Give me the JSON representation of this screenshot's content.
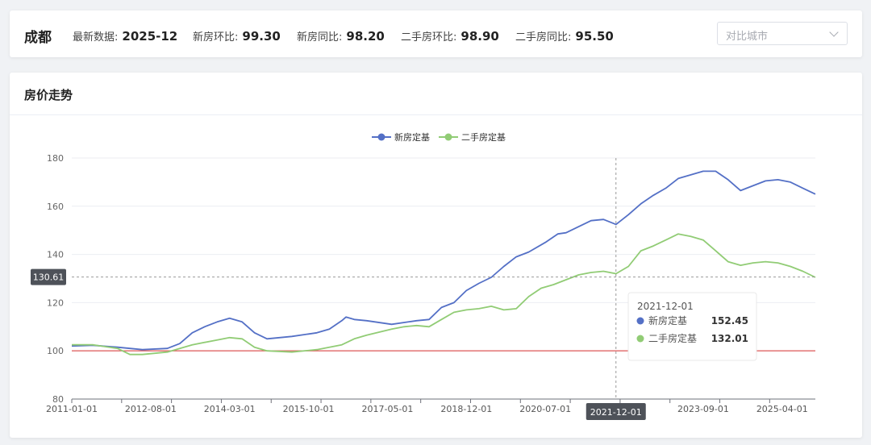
{
  "header": {
    "city": "成都",
    "stats": [
      {
        "label": "最新数据:",
        "value": "2025-12"
      },
      {
        "label": "新房环比:",
        "value": "99.30"
      },
      {
        "label": "新房同比:",
        "value": "98.20"
      },
      {
        "label": "二手房环比:",
        "value": "98.90"
      },
      {
        "label": "二手房同比:",
        "value": "95.50"
      }
    ],
    "compare_placeholder": "对比城市"
  },
  "panel": {
    "title": "房价走势"
  },
  "colors": {
    "new_house": "#5470c6",
    "second_hand": "#91cc75",
    "baseline": "#e06666",
    "crosshair": "#999999",
    "axis_label_bg": "#4e5259"
  },
  "chart_data": {
    "type": "line",
    "ylim": [
      80,
      180
    ],
    "yticks": [
      80,
      100,
      120,
      140,
      160,
      180
    ],
    "xlim": [
      "2011-01-01",
      "2025-12-01"
    ],
    "x_tick_labels": [
      "2011-01-01",
      "2012-08-01",
      "2014-03-01",
      "2015-10-01",
      "2017-05-01",
      "2018-12-01",
      "2020-07-01",
      "2023-09-01",
      "2025-04-01"
    ],
    "reference_line": 100,
    "legend": {
      "position": "top-center"
    },
    "series": [
      {
        "name": "新房定基",
        "points": [
          [
            "2011-01-01",
            102.0
          ],
          [
            "2011-06-01",
            102.3
          ],
          [
            "2011-12-01",
            101.5
          ],
          [
            "2012-06-01",
            100.5
          ],
          [
            "2012-12-01",
            101.0
          ],
          [
            "2013-03-01",
            103.0
          ],
          [
            "2013-06-01",
            107.5
          ],
          [
            "2013-09-01",
            110.0
          ],
          [
            "2013-12-01",
            112.0
          ],
          [
            "2014-03-01",
            113.5
          ],
          [
            "2014-06-01",
            112.0
          ],
          [
            "2014-09-01",
            107.5
          ],
          [
            "2014-12-01",
            105.0
          ],
          [
            "2015-06-01",
            106.0
          ],
          [
            "2015-12-01",
            107.5
          ],
          [
            "2016-03-01",
            109.0
          ],
          [
            "2016-06-01",
            112.5
          ],
          [
            "2016-07-01",
            114.0
          ],
          [
            "2016-09-01",
            113.0
          ],
          [
            "2016-12-01",
            112.5
          ],
          [
            "2017-06-01",
            111.0
          ],
          [
            "2017-12-01",
            112.5
          ],
          [
            "2018-03-01",
            113.0
          ],
          [
            "2018-06-01",
            118.0
          ],
          [
            "2018-09-01",
            120.0
          ],
          [
            "2018-12-01",
            125.0
          ],
          [
            "2019-03-01",
            128.0
          ],
          [
            "2019-06-01",
            130.5
          ],
          [
            "2019-09-01",
            135.0
          ],
          [
            "2019-12-01",
            139.0
          ],
          [
            "2020-03-01",
            141.0
          ],
          [
            "2020-07-01",
            145.0
          ],
          [
            "2020-10-01",
            148.5
          ],
          [
            "2020-12-01",
            149.0
          ],
          [
            "2021-03-01",
            151.5
          ],
          [
            "2021-06-01",
            154.0
          ],
          [
            "2021-09-01",
            154.5
          ],
          [
            "2021-12-01",
            152.45
          ],
          [
            "2022-03-01",
            156.5
          ],
          [
            "2022-06-01",
            161.0
          ],
          [
            "2022-09-01",
            164.5
          ],
          [
            "2022-12-01",
            167.5
          ],
          [
            "2023-03-01",
            171.5
          ],
          [
            "2023-06-01",
            173.0
          ],
          [
            "2023-09-01",
            174.5
          ],
          [
            "2023-12-01",
            174.5
          ],
          [
            "2024-03-01",
            171.0
          ],
          [
            "2024-06-01",
            166.5
          ],
          [
            "2024-09-01",
            168.5
          ],
          [
            "2024-12-01",
            170.5
          ],
          [
            "2025-03-01",
            171.0
          ],
          [
            "2025-06-01",
            170.0
          ],
          [
            "2025-09-01",
            167.5
          ],
          [
            "2025-12-01",
            165.0
          ]
        ]
      },
      {
        "name": "二手房定基",
        "points": [
          [
            "2011-01-01",
            102.5
          ],
          [
            "2011-06-01",
            102.5
          ],
          [
            "2011-12-01",
            101.0
          ],
          [
            "2012-03-01",
            98.5
          ],
          [
            "2012-06-01",
            98.5
          ],
          [
            "2012-12-01",
            99.5
          ],
          [
            "2013-06-01",
            102.5
          ],
          [
            "2013-12-01",
            104.5
          ],
          [
            "2014-03-01",
            105.5
          ],
          [
            "2014-06-01",
            105.0
          ],
          [
            "2014-09-01",
            101.5
          ],
          [
            "2014-12-01",
            100.0
          ],
          [
            "2015-06-01",
            99.5
          ],
          [
            "2015-12-01",
            100.5
          ],
          [
            "2016-06-01",
            102.5
          ],
          [
            "2016-09-01",
            105.0
          ],
          [
            "2016-12-01",
            106.5
          ],
          [
            "2017-06-01",
            109.0
          ],
          [
            "2017-09-01",
            110.0
          ],
          [
            "2017-12-01",
            110.5
          ],
          [
            "2018-03-01",
            110.0
          ],
          [
            "2018-06-01",
            113.0
          ],
          [
            "2018-09-01",
            116.0
          ],
          [
            "2018-12-01",
            117.0
          ],
          [
            "2019-03-01",
            117.5
          ],
          [
            "2019-06-01",
            118.5
          ],
          [
            "2019-09-01",
            117.0
          ],
          [
            "2019-12-01",
            117.5
          ],
          [
            "2020-03-01",
            122.5
          ],
          [
            "2020-06-01",
            126.0
          ],
          [
            "2020-09-01",
            127.5
          ],
          [
            "2020-12-01",
            129.5
          ],
          [
            "2021-03-01",
            131.5
          ],
          [
            "2021-06-01",
            132.5
          ],
          [
            "2021-09-01",
            133.0
          ],
          [
            "2021-12-01",
            132.01
          ],
          [
            "2022-03-01",
            135.0
          ],
          [
            "2022-06-01",
            141.5
          ],
          [
            "2022-09-01",
            143.5
          ],
          [
            "2022-12-01",
            146.0
          ],
          [
            "2023-03-01",
            148.5
          ],
          [
            "2023-06-01",
            147.5
          ],
          [
            "2023-09-01",
            146.0
          ],
          [
            "2023-12-01",
            141.5
          ],
          [
            "2024-03-01",
            137.0
          ],
          [
            "2024-06-01",
            135.5
          ],
          [
            "2024-09-01",
            136.5
          ],
          [
            "2024-12-01",
            137.0
          ],
          [
            "2025-03-01",
            136.5
          ],
          [
            "2025-06-01",
            135.0
          ],
          [
            "2025-09-01",
            133.0
          ],
          [
            "2025-12-01",
            130.5
          ]
        ]
      }
    ],
    "crosshair": {
      "x_label": "2021-12-01",
      "y_label": "130.61"
    },
    "tooltip": {
      "date": "2021-12-01",
      "rows": [
        {
          "name": "新房定基",
          "value": "152.45"
        },
        {
          "name": "二手房定基",
          "value": "132.01"
        }
      ]
    }
  }
}
